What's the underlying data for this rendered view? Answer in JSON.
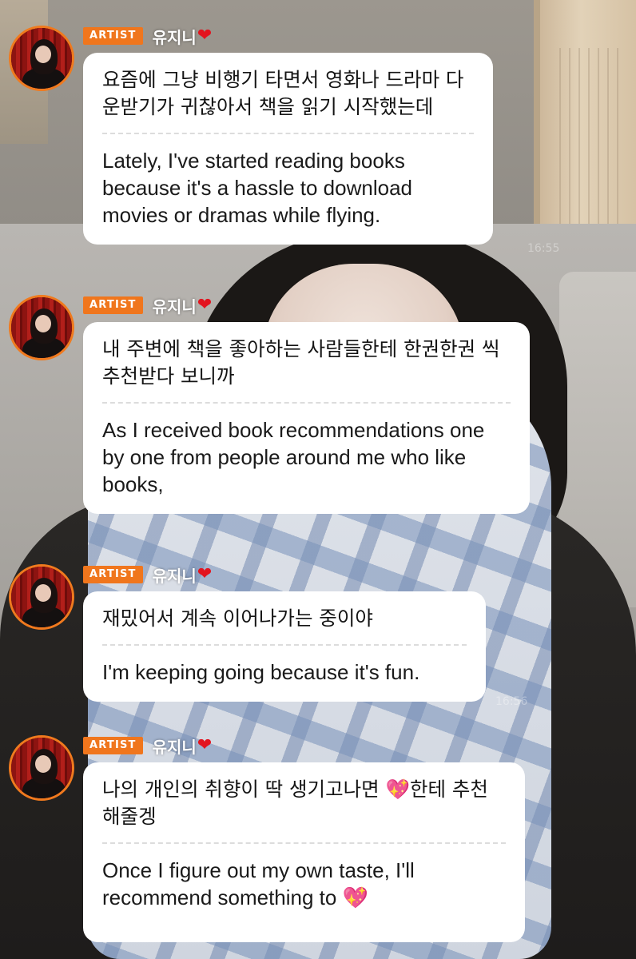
{
  "messages": [
    {
      "badge": "ARTIST",
      "username": "유지니",
      "heart": "❤",
      "korean": "요즘에 그냥 비행기 타면서 영화나 드라마 다 운받기가 귀찮아서 책을 읽기 시작했는데",
      "english": "Lately, I've started reading books because it's a hassle to download movies or dramas while flying."
    },
    {
      "badge": "ARTIST",
      "username": "유지니",
      "heart": "❤",
      "korean": "내 주변에 책을 좋아하는 사람들한테 한권한권 씩 추천받다 보니까",
      "english": "As I received book recommendations one by one from people around me who like books,"
    },
    {
      "badge": "ARTIST",
      "username": "유지니",
      "heart": "❤",
      "korean": "재밌어서 계속 이어나가는 중이야",
      "english": "I'm keeping going because it's fun."
    },
    {
      "badge": "ARTIST",
      "username": "유지니",
      "heart": "❤",
      "korean": "나의 개인의 취향이 딱 생기고나면 💖한테 추천해줄겡",
      "english": "Once I figure out my own taste, I'll recommend something to 💖"
    }
  ],
  "timestamps": [
    "16:55",
    "16:56"
  ],
  "colors": {
    "badge": "#f0761d",
    "avatar_ring": "#f07a1e",
    "heart": "#e3141f",
    "sparkle_heart": "#e0359c"
  },
  "icons": {
    "heart": "red-heart-icon",
    "sparkle_heart": "sparkling-heart-icon"
  }
}
